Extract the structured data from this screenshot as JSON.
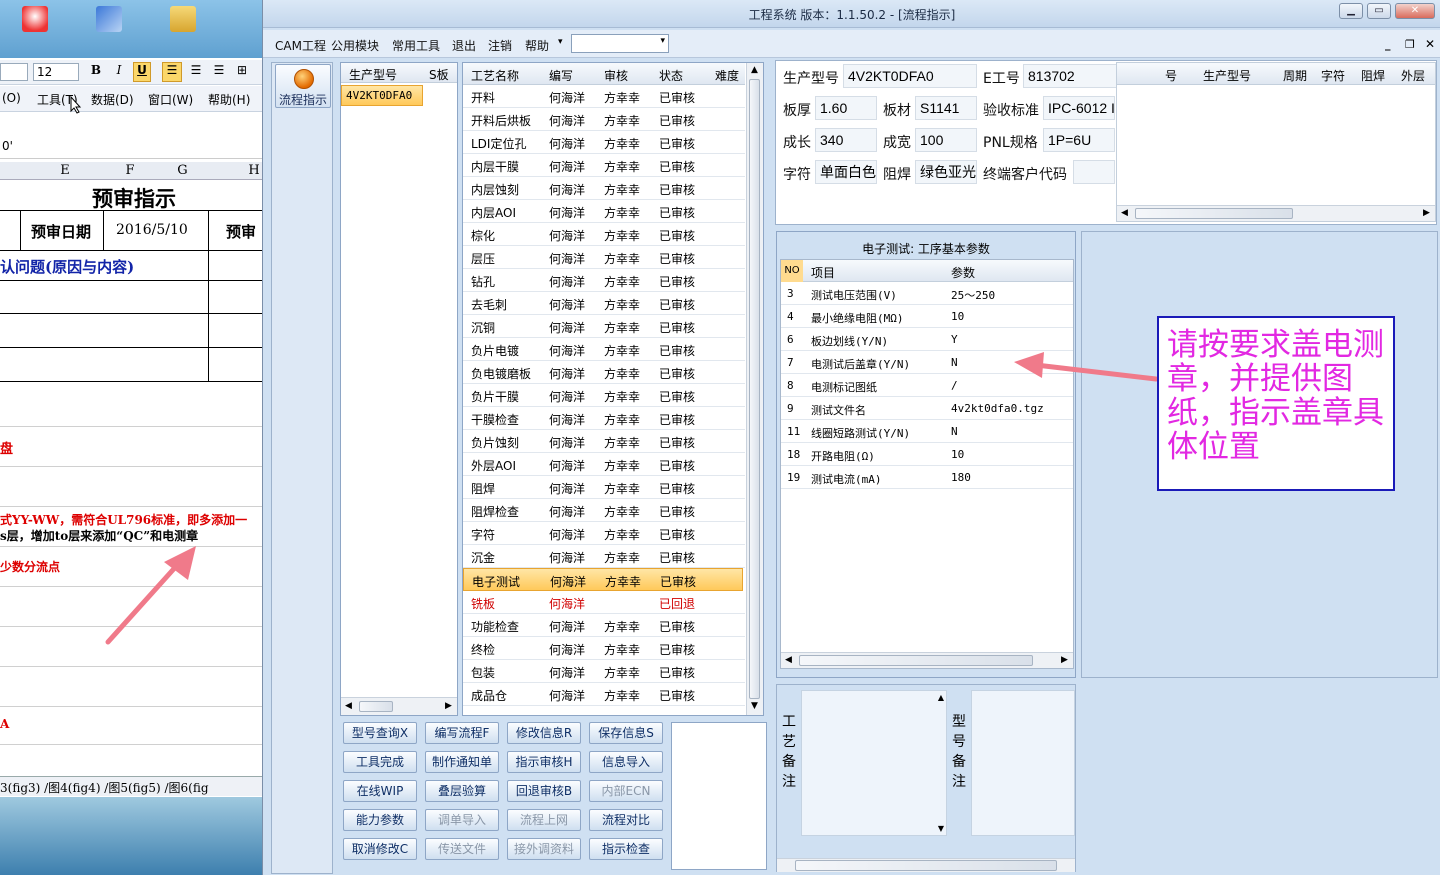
{
  "excel": {
    "font_size": "12",
    "menu": [
      "(O)",
      "工具(T)",
      "数据(D)",
      "窗口(W)",
      "帮助(H)"
    ],
    "formula_text": "0'",
    "columns": [
      "E",
      "F",
      "G",
      "H"
    ],
    "title": "预审指示",
    "date_label": "预审日期",
    "date_value": "2016/5/10",
    "trunc_label": "预审",
    "issue_header": "认问题(原因与内容)",
    "row_pan": "盘",
    "note_line1": "式YY-WW，需符合UL796标准，即多添加一",
    "note_line2": "s层，增加to层来添加“QC”和电测章",
    "note_line3": "少数分流点",
    "note_mark": "A",
    "sheet_tabs": "3(fig3) /图4(fig4) /图5(fig5) /图6(fig"
  },
  "app": {
    "title": "工程系统   版本：1.1.50.2 - [流程指示]",
    "menu": [
      "CAM工程",
      "公用模块",
      "常用工具",
      "退出",
      "注销",
      "帮助"
    ],
    "launch_label": "流程指示",
    "model_list": {
      "headers": [
        "生产型号",
        "S板"
      ],
      "items": [
        "4V2KT0DFA0"
      ]
    },
    "process_table": {
      "headers": [
        "工艺名称",
        "编写",
        "审核",
        "状态",
        "难度"
      ],
      "rows": [
        [
          "开料",
          "何海洋",
          "方幸幸",
          "已审核"
        ],
        [
          "开料后烘板",
          "何海洋",
          "方幸幸",
          "已审核"
        ],
        [
          "LDI定位孔",
          "何海洋",
          "方幸幸",
          "已审核"
        ],
        [
          "内层干膜",
          "何海洋",
          "方幸幸",
          "已审核"
        ],
        [
          "内层蚀刻",
          "何海洋",
          "方幸幸",
          "已审核"
        ],
        [
          "内层AOI",
          "何海洋",
          "方幸幸",
          "已审核"
        ],
        [
          "棕化",
          "何海洋",
          "方幸幸",
          "已审核"
        ],
        [
          "层压",
          "何海洋",
          "方幸幸",
          "已审核"
        ],
        [
          "钻孔",
          "何海洋",
          "方幸幸",
          "已审核"
        ],
        [
          "去毛刺",
          "何海洋",
          "方幸幸",
          "已审核"
        ],
        [
          "沉铜",
          "何海洋",
          "方幸幸",
          "已审核"
        ],
        [
          "负片电镀",
          "何海洋",
          "方幸幸",
          "已审核"
        ],
        [
          "负电镀磨板",
          "何海洋",
          "方幸幸",
          "已审核"
        ],
        [
          "负片干膜",
          "何海洋",
          "方幸幸",
          "已审核"
        ],
        [
          "干膜检查",
          "何海洋",
          "方幸幸",
          "已审核"
        ],
        [
          "负片蚀刻",
          "何海洋",
          "方幸幸",
          "已审核"
        ],
        [
          "外层AOI",
          "何海洋",
          "方幸幸",
          "已审核"
        ],
        [
          "阻焊",
          "何海洋",
          "方幸幸",
          "已审核"
        ],
        [
          "阻焊检查",
          "何海洋",
          "方幸幸",
          "已审核"
        ],
        [
          "字符",
          "何海洋",
          "方幸幸",
          "已审核"
        ],
        [
          "沉金",
          "何海洋",
          "方幸幸",
          "已审核"
        ],
        [
          "电子测试",
          "何海洋",
          "方幸幸",
          "已审核"
        ],
        [
          "铣板",
          "何海洋",
          "",
          "已回退"
        ],
        [
          "功能检查",
          "何海洋",
          "方幸幸",
          "已审核"
        ],
        [
          "终检",
          "何海洋",
          "方幸幸",
          "已审核"
        ],
        [
          "包装",
          "何海洋",
          "方幸幸",
          "已审核"
        ],
        [
          "成品仓",
          "何海洋",
          "方幸幸",
          "已审核"
        ]
      ],
      "selected_row": 21,
      "returned_row": 22
    },
    "buttons": [
      [
        "型号查询X",
        "编写流程F",
        "修改信息R",
        "保存信息S"
      ],
      [
        "工具完成",
        "制作通知单",
        "指示审核H",
        "信息导入"
      ],
      [
        "在线WIP",
        "叠层验算",
        "回退审核B",
        "内部ECN"
      ],
      [
        "能力参数",
        "调单导入",
        "流程上网",
        "流程对比"
      ],
      [
        "取消修改C",
        "传送文件",
        "接外调资料",
        "指示检查"
      ]
    ],
    "disabled_buttons": [
      "内部ECN",
      "调单导入",
      "流程上网",
      "传送文件",
      "接外调资料"
    ],
    "info": {
      "model_label": "生产型号",
      "model_value": "4V2KT0DFA0",
      "eno_label": "E工号",
      "eno_value": "813702",
      "thick_label": "板厚",
      "thick_value": "1.60",
      "mat_label": "板材",
      "mat_value": "S1141",
      "std_label": "验收标准",
      "std_value": "IPC-6012 I",
      "len_label": "成长",
      "len_value": "340",
      "wid_label": "成宽",
      "wid_value": "100",
      "pnl_label": "PNL规格",
      "pnl_value": "1P=6U",
      "char_label": "字符",
      "char_value": "单面白色",
      "mask_label": "阻焊",
      "mask_value": "绿色亚光",
      "cust_label": "终端客户代码",
      "cust_value": ""
    },
    "side_grid_headers": [
      "号",
      "生产型号",
      "周期",
      "字符",
      "阻焊",
      "外层"
    ],
    "param_table": {
      "title": "电子测试: 工序基本参数",
      "headers": [
        "NO",
        "项目",
        "参数"
      ],
      "rows": [
        [
          "3",
          "测试电压范围(V)",
          "25～250"
        ],
        [
          "4",
          "最小绝缘电阻(MΩ)",
          "10"
        ],
        [
          "6",
          "板边划线(Y/N)",
          "Y"
        ],
        [
          "7",
          "电测试后盖章(Y/N)",
          "N"
        ],
        [
          "8",
          "电测标记图纸",
          "/"
        ],
        [
          "9",
          "测试文件名",
          "4v2kt0dfa0.tgz"
        ],
        [
          "11",
          "线圈短路测试(Y/N)",
          "N"
        ],
        [
          "18",
          "开路电阻(Ω)",
          "10"
        ],
        [
          "19",
          "测试电流(mA)",
          "180"
        ]
      ]
    },
    "process_remark_label": "工艺备注",
    "model_remark_label": "型号备注",
    "annotation": "请按要求盖电测章，并提供图纸，指示盖章具体位置",
    "annotation_color": "#e228e2"
  }
}
